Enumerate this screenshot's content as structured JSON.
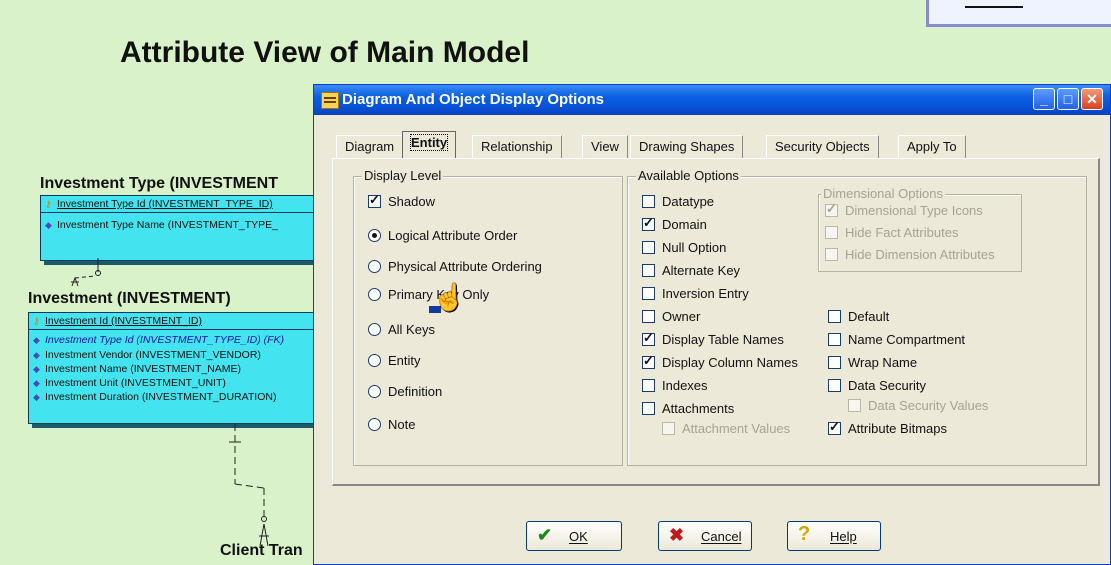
{
  "page_title": "Attribute View of Main Model",
  "entities": {
    "investment_type": {
      "title": "Investment Type (INVESTMENT",
      "rows": [
        "Investment Type Id (INVESTMENT_TYPE_ID)",
        "Investment Type Name (INVESTMENT_TYPE_"
      ]
    },
    "investment": {
      "title": "Investment (INVESTMENT)",
      "key_rows": [
        "Investment Id (INVESTMENT_ID)"
      ],
      "rows": [
        "Investment Type Id (INVESTMENT_TYPE_ID) (FK)",
        "Investment Vendor (INVESTMENT_VENDOR)",
        "Investment Name (INVESTMENT_NAME)",
        "Investment Unit (INVESTMENT_UNIT)",
        "Investment Duration (INVESTMENT_DURATION)"
      ]
    },
    "client_tran": {
      "title": "Client Tran"
    }
  },
  "dialog": {
    "title": "Diagram And Object Display Options",
    "tabs": [
      "Diagram",
      "Entity",
      "Relationship",
      "View",
      "Drawing Shapes",
      "Security Objects",
      "Apply To"
    ],
    "active_tab": "Entity",
    "display_level": {
      "label": "Display Level",
      "shadow": {
        "label": "Shadow",
        "checked": true
      },
      "options": [
        {
          "label": "Logical Attribute Order",
          "selected": true
        },
        {
          "label": "Physical Attribute Ordering",
          "selected": false
        },
        {
          "label": "Primary Key Only",
          "selected": false
        },
        {
          "label": "All Keys",
          "selected": false
        },
        {
          "label": "Entity",
          "selected": false
        },
        {
          "label": "Definition",
          "selected": false
        },
        {
          "label": "Note",
          "selected": false
        }
      ]
    },
    "available_options": {
      "label": "Available Options",
      "left": [
        {
          "label": "Datatype",
          "checked": false
        },
        {
          "label": "Domain",
          "checked": true
        },
        {
          "label": "Null Option",
          "checked": false
        },
        {
          "label": "Alternate Key",
          "checked": false
        },
        {
          "label": "Inversion Entry",
          "checked": false
        },
        {
          "label": "Owner",
          "checked": false
        },
        {
          "label": "Display Table Names",
          "checked": true
        },
        {
          "label": "Display Column Names",
          "checked": true
        },
        {
          "label": "Indexes",
          "checked": false
        },
        {
          "label": "Attachments",
          "checked": false
        },
        {
          "label": "Attachment Values",
          "checked": false,
          "disabled": true
        }
      ],
      "dimensional": {
        "label": "Dimensional Options",
        "items": [
          {
            "label": "Dimensional Type Icons",
            "checked": true
          },
          {
            "label": "Hide Fact Attributes",
            "checked": false
          },
          {
            "label": "Hide Dimension Attributes",
            "checked": false
          }
        ]
      },
      "right": [
        {
          "label": "Default",
          "checked": false
        },
        {
          "label": "Name Compartment",
          "checked": false
        },
        {
          "label": "Wrap Name",
          "checked": false
        },
        {
          "label": "Data Security",
          "checked": false
        },
        {
          "label": "Data Security Values",
          "checked": false,
          "disabled": true
        },
        {
          "label": "Attribute Bitmaps",
          "checked": true
        }
      ]
    },
    "buttons": {
      "ok": "OK",
      "cancel": "Cancel",
      "help": "Help"
    }
  }
}
